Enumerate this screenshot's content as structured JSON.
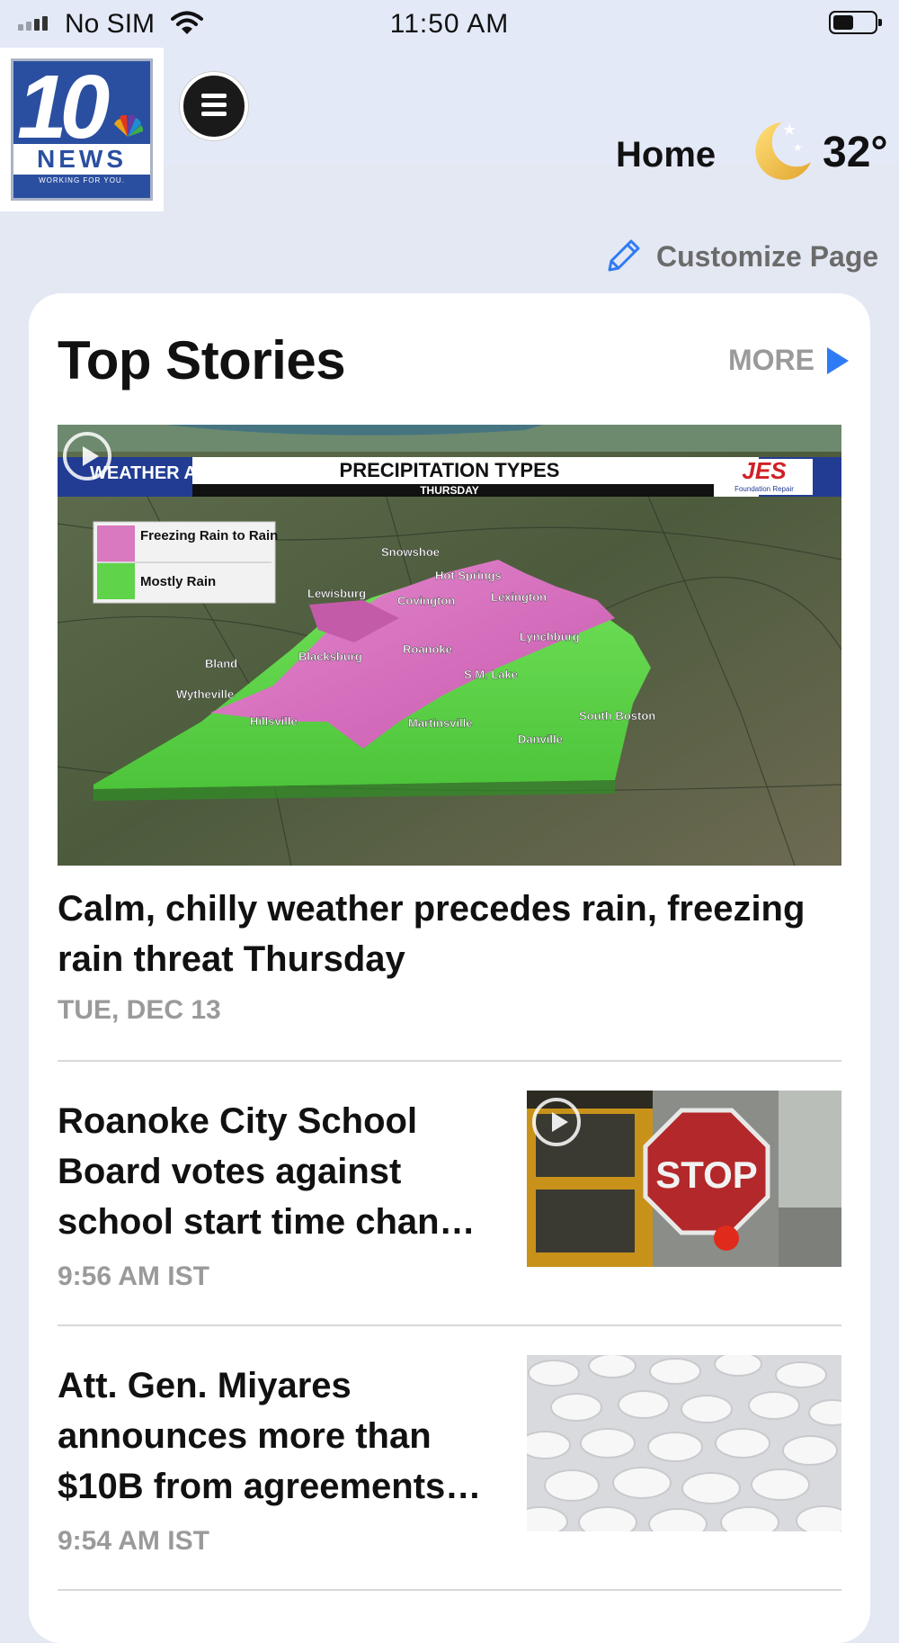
{
  "status_bar": {
    "carrier": "No SIM",
    "time": "11:50 AM"
  },
  "header": {
    "logo": {
      "number": "10",
      "name": "NEWS",
      "tagline": "WORKING FOR YOU."
    },
    "page_label": "Home",
    "weather": {
      "icon": "moon-stars-icon",
      "temperature": "32°"
    }
  },
  "customize": {
    "label": "Customize Page",
    "icon": "pencil-icon"
  },
  "top_stories": {
    "title": "Top Stories",
    "more_label": "MORE",
    "hero": {
      "headline": "Calm, chilly weather precedes rain, freezing rain threat Thursday",
      "date": "TUE, DEC 13",
      "graphic": {
        "brand": "WEATHER AUTHORITY",
        "title": "PRECIPITATION TYPES",
        "subtitle": "THURSDAY",
        "sponsor": "JES",
        "sponsor_sub": "Foundation Repair",
        "legend": [
          "Freezing Rain to Rain",
          "Mostly Rain"
        ],
        "places": [
          "Snowshoe",
          "Hot Springs",
          "Lewisburg",
          "Covington",
          "Lexington",
          "Lynchburg",
          "Roanoke",
          "Blacksburg",
          "Bland",
          "Wytheville",
          "S.M. Lake",
          "Hillsville",
          "Martinsville",
          "South Boston",
          "Danville"
        ]
      }
    },
    "stories": [
      {
        "headline": "Roanoke City School Board votes against school start time chan…",
        "time": "9:56 AM IST",
        "thumb_text": "STOP"
      },
      {
        "headline": "Att. Gen. Miyares announces more than $10B from agreements…",
        "time": "9:54 AM IST"
      }
    ]
  },
  "colors": {
    "accent": "#2f7bf5",
    "freezing_rain": "#d979bf",
    "mostly_rain": "#5fd34a"
  }
}
